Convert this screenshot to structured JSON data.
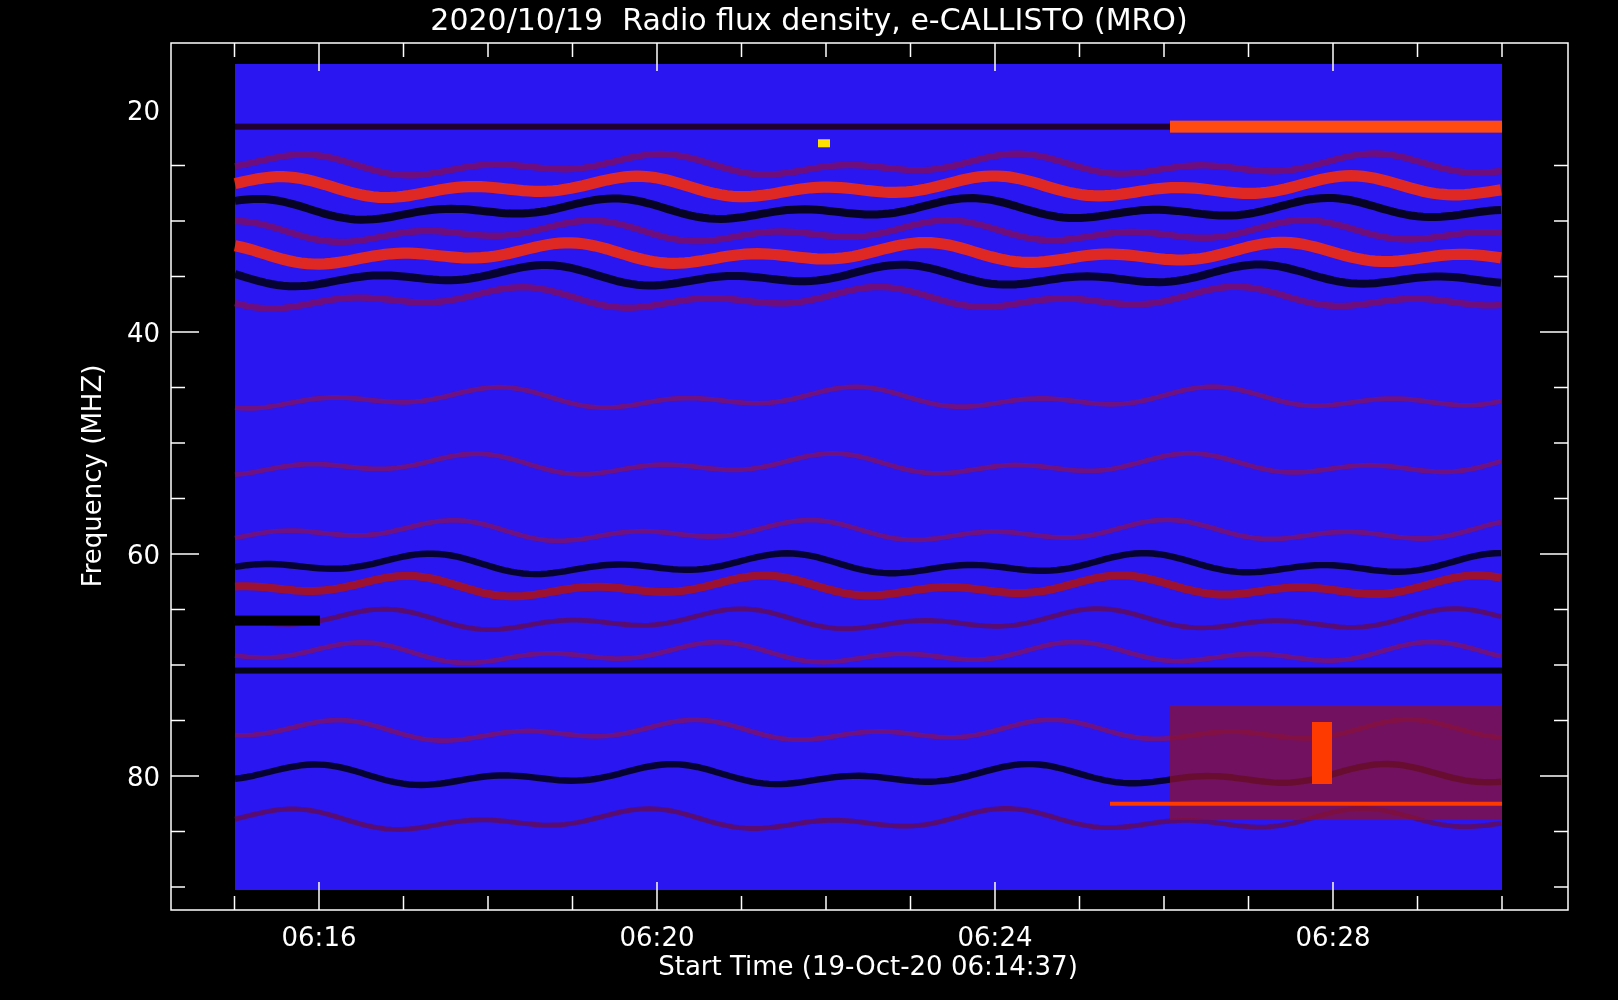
{
  "title": "2020/10/19  Radio flux density, e-CALLISTO (MRO)",
  "x_axis": {
    "label": "Start Time (19-Oct-20 06:14:37)",
    "tick_labels": [
      "06:16",
      "06:20",
      "06:24",
      "06:28"
    ]
  },
  "y_axis": {
    "label": "Frequency (MHZ)",
    "tick_labels": [
      "20",
      "40",
      "60",
      "80"
    ]
  }
}
